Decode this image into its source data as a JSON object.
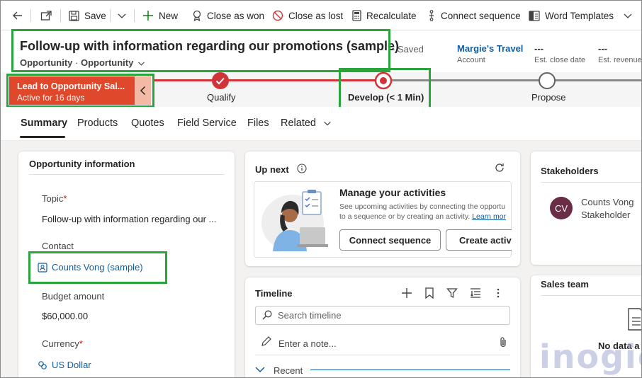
{
  "toolbar": {
    "save": "Save",
    "new": "New",
    "close_won": "Close as won",
    "close_lost": "Close as lost",
    "recalculate": "Recalculate",
    "connect_sequence": "Connect sequence",
    "word_templates": "Word Templates"
  },
  "header": {
    "title": "Follow-up with information regarding our promotions (sample)",
    "saved_status": "- Saved",
    "entity": "Opportunity",
    "form_selector": "Opportunity",
    "fields": [
      {
        "value": "Margie's Travel",
        "label": "Account"
      },
      {
        "value": "---",
        "label": "Est. close date"
      },
      {
        "value": "---",
        "label": "Est. revenue"
      }
    ]
  },
  "bpf": {
    "active_process": "Lead to Opportunity Sal...",
    "active_duration": "Active for 16 days",
    "stages": [
      "Qualify",
      "Develop  (< 1 Min)",
      "Propose"
    ]
  },
  "tabs": [
    "Summary",
    "Products",
    "Quotes",
    "Field Service",
    "Files",
    "Related"
  ],
  "opportunity_info": {
    "title": "Opportunity information",
    "topic_label": "Topic",
    "topic_value": "Follow-up with information regarding our ...",
    "contact_label": "Contact",
    "contact_value": "Counts Vong (sample)",
    "budget_label": "Budget amount",
    "budget_value": "$60,000.00",
    "currency_label": "Currency",
    "currency_value": "US Dollar"
  },
  "up_next": {
    "title": "Up next",
    "heading": "Manage your activities",
    "desc_line1": "See upcoming activities by connecting the opportu",
    "desc_line2": "to a sequence or by creating an activity.",
    "learn_more": "Learn mor",
    "connect_btn": "Connect sequence",
    "create_btn": "Create activi"
  },
  "timeline": {
    "title": "Timeline",
    "search_placeholder": "Search timeline",
    "note_placeholder": "Enter a note...",
    "recent": "Recent"
  },
  "stakeholders": {
    "title": "Stakeholders",
    "initials": "CV",
    "name": "Counts Vong",
    "role": "Stakeholder"
  },
  "sales_team": {
    "title": "Sales team",
    "empty": "No data a"
  },
  "watermark": "inogic",
  "colors": {
    "highlight": "#2aa53b",
    "stage_active": "#e0482c",
    "link": "#115ea3",
    "avatar": "#6b2c45"
  }
}
